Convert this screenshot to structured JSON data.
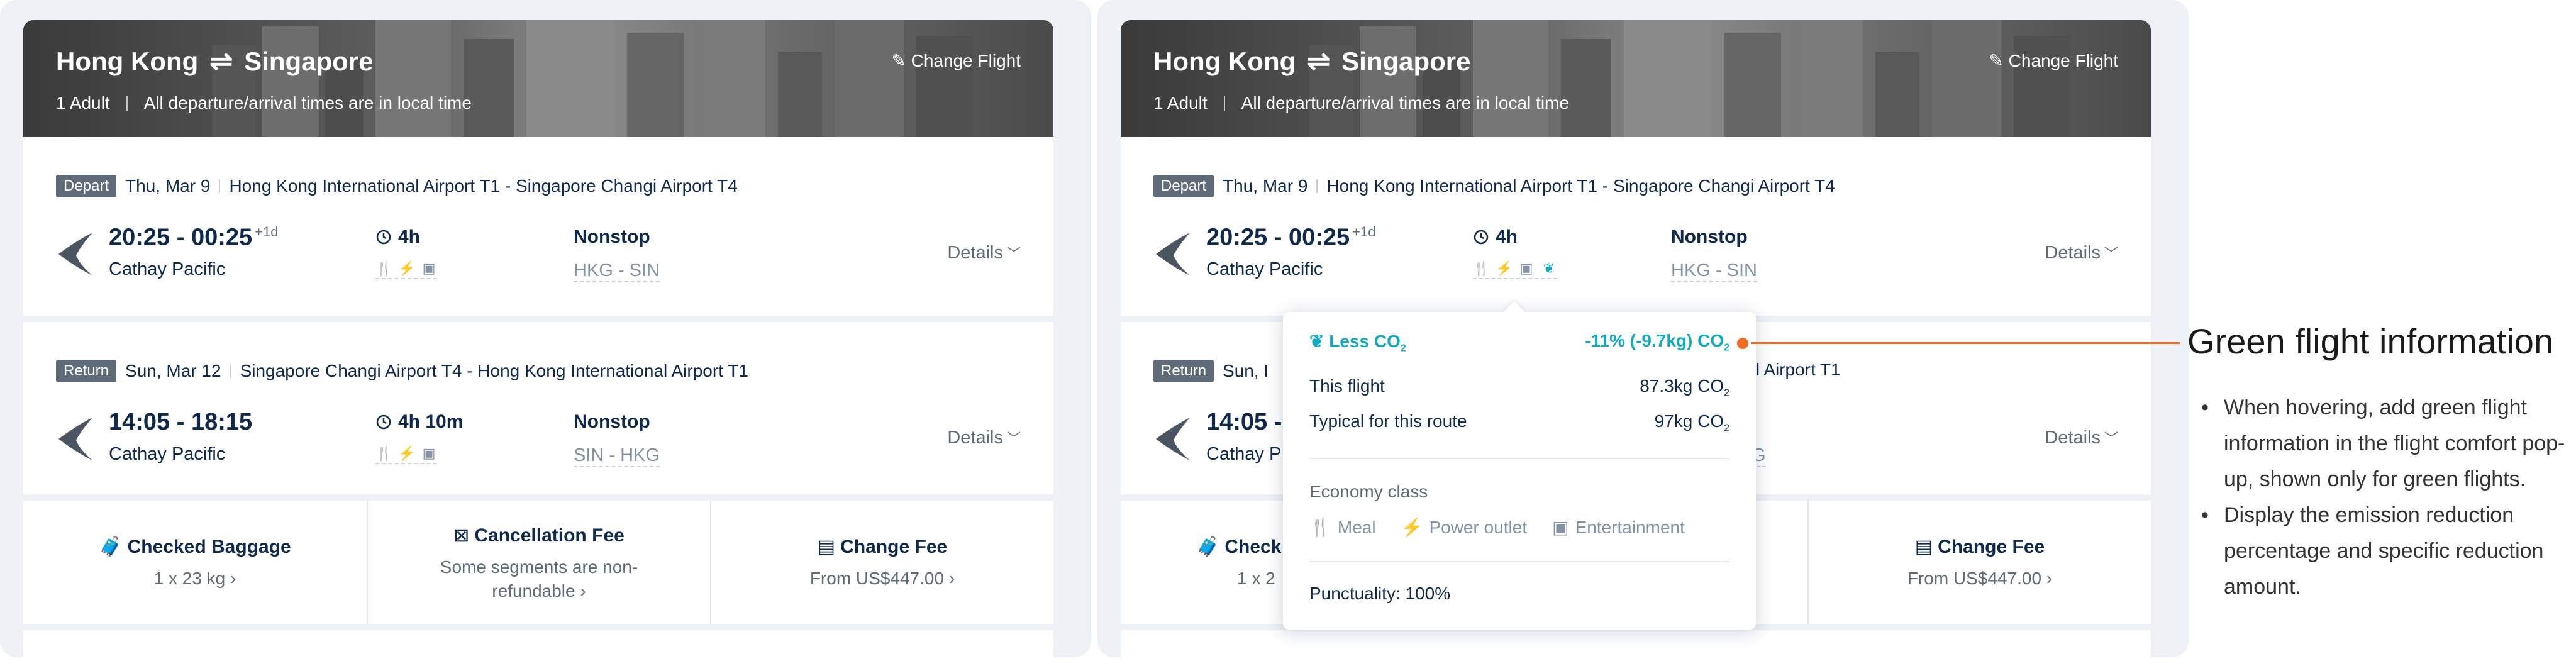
{
  "header": {
    "origin": "Hong Kong",
    "destination": "Singapore",
    "swap_glyph": "⇌",
    "passengers": "1 Adult",
    "time_note": "All departure/arrival times are in local time",
    "change_flight": "Change Flight"
  },
  "depart": {
    "badge": "Depart",
    "date": "Thu, Mar 9",
    "route": "Hong Kong International Airport T1 - Singapore Changi Airport T4",
    "times": "20:25 - 00:25",
    "day_offset": "+1d",
    "airline": "Cathay Pacific",
    "duration": "4h",
    "stops": "Nonstop",
    "codes": "HKG - SIN",
    "details": "Details"
  },
  "return": {
    "badge": "Return",
    "date": "Sun, Mar 12",
    "route": "Singapore Changi Airport T4 - Hong Kong International Airport T1",
    "times": "14:05 - 18:15",
    "airline": "Cathay Pacific",
    "duration": "4h 10m",
    "stops": "Nonstop",
    "codes": "SIN - HKG",
    "details": "Details"
  },
  "return_partial": {
    "date": "Sun, I",
    "route_tail": "national Airport T1",
    "times": "14:05 -",
    "airline": "Cathay P",
    "codes_tail": "G"
  },
  "fees": [
    {
      "title": "Checked Baggage",
      "value": "1 x 23 kg"
    },
    {
      "title": "Cancellation Fee",
      "value": "Some segments are non-refundable"
    },
    {
      "title": "Change Fee",
      "value": "From US$447.00"
    }
  ],
  "fees_partial": {
    "title": "Check",
    "value": "1 x 2"
  },
  "popup": {
    "less_label": "Less CO",
    "reduction": "-11% (-9.7kg) CO",
    "this_flight_label": "This flight",
    "this_flight_value": "87.3kg CO",
    "typical_label": "Typical for this route",
    "typical_value": "97kg CO",
    "co2_sub": "2",
    "class_label": "Economy class",
    "amenities": [
      "Meal",
      "Power outlet",
      "Entertainment"
    ],
    "punctuality": "Punctuality: 100%"
  },
  "annotation": {
    "title": "Green flight information",
    "bullets": [
      "When hovering, add green flight information in the flight comfort pop-up, shown only for green flights.",
      "Display the emission reduction percentage and specific reduction amount."
    ]
  },
  "colors": {
    "accent_green": "#11a9c2",
    "callout": "#f06d28",
    "text": "#0f294d"
  },
  "icons": [
    "edit-icon",
    "clock-icon",
    "meal-icon",
    "power-icon",
    "entertainment-icon",
    "leaf-icon",
    "airline-logo",
    "chevron-down-icon",
    "chevron-right-icon",
    "baggage-icon",
    "cancel-icon",
    "calendar-icon"
  ]
}
